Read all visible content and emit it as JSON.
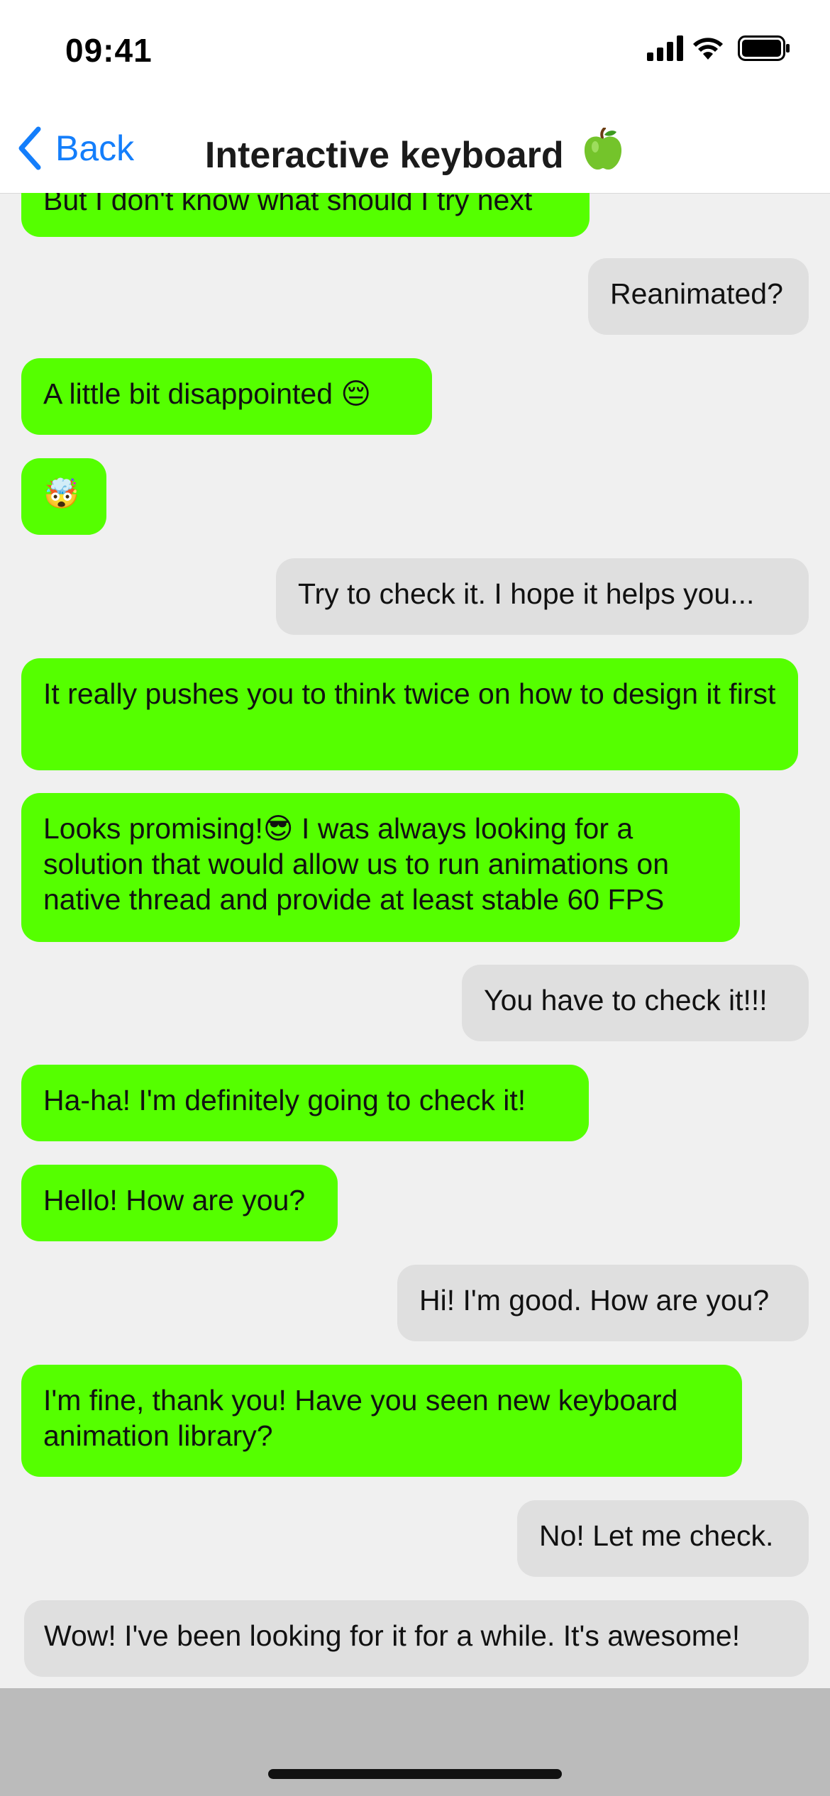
{
  "status_bar": {
    "time": "09:41",
    "icons": [
      "cellular-signal-icon",
      "wifi-icon",
      "battery-icon"
    ]
  },
  "header": {
    "back_label": "Back",
    "title": "Interactive keyboard",
    "title_icon": "green-apple-icon"
  },
  "colors": {
    "incoming_bubble": "#55ff00",
    "outgoing_bubble": "#dfdfdf",
    "link_blue": "#147efb",
    "chat_background": "#f0f0f0",
    "bottom_background": "#bbbbbb"
  },
  "messages": [
    {
      "side": "in",
      "text": "But I don't know what should I try next"
    },
    {
      "side": "out",
      "text": "Reanimated?"
    },
    {
      "side": "in",
      "text": "A little bit disappointed 😔"
    },
    {
      "side": "in",
      "text": "🤯"
    },
    {
      "side": "out",
      "text": "Try to check it. I hope it helps you..."
    },
    {
      "side": "in",
      "text": "It really pushes you to think twice on how to design it first"
    },
    {
      "side": "in",
      "text": "Looks promising!😎 I was always looking for a solution that would allow us to run animations on native thread and provide at least stable 60 FPS"
    },
    {
      "side": "out",
      "text": "You have to check it!!!"
    },
    {
      "side": "in",
      "text": "Ha-ha! I'm definitely going to check it!"
    },
    {
      "side": "in",
      "text": "Hello! How are you?"
    },
    {
      "side": "out",
      "text": "Hi! I'm good. How are you?"
    },
    {
      "side": "in",
      "text": "I'm fine, thank you! Have you seen new keyboard animation library?"
    },
    {
      "side": "out",
      "text": "No! Let me check."
    },
    {
      "side": "out",
      "text": "Wow! I've been looking for it for a while. It's awesome!"
    }
  ]
}
